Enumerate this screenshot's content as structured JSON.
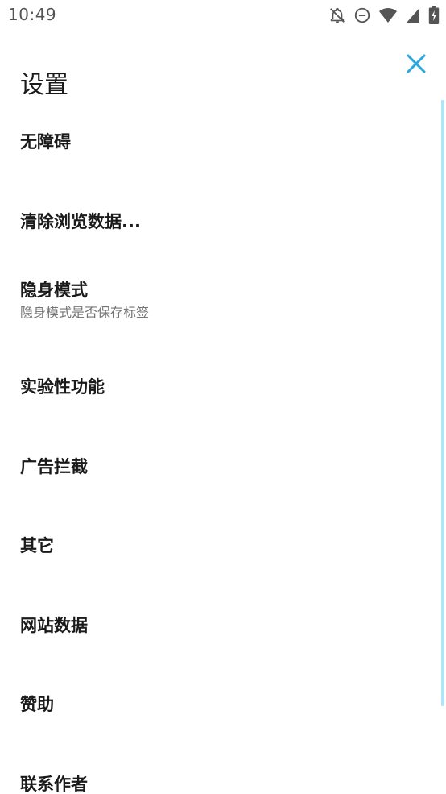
{
  "status_bar": {
    "time": "10:49",
    "icons": [
      "notifications-off-icon",
      "do-not-disturb-icon",
      "wifi-icon",
      "signal-icon",
      "battery-charging-icon"
    ]
  },
  "header": {
    "title": "设置",
    "close_icon": "close-icon",
    "accent_color": "#29a8e0"
  },
  "settings": {
    "items": [
      {
        "label": "无障碍"
      },
      {
        "label": "清除浏览数据..."
      },
      {
        "label": "隐身模式",
        "subtitle": "隐身模式是否保存标签"
      },
      {
        "label": "实验性功能"
      },
      {
        "label": "广告拦截"
      },
      {
        "label": "其它"
      },
      {
        "label": "网站数据"
      },
      {
        "label": "赞助"
      },
      {
        "label": "联系作者"
      }
    ]
  },
  "scrollbar_color": "#b3e3f7"
}
